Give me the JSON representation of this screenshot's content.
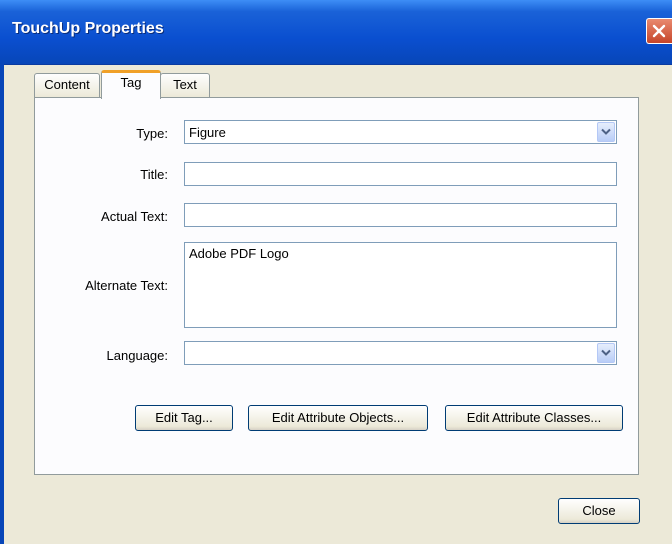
{
  "window": {
    "title": "TouchUp Properties"
  },
  "tabs": [
    {
      "label": "Content"
    },
    {
      "label": "Tag"
    },
    {
      "label": "Text"
    }
  ],
  "active_tab": "Tag",
  "form": {
    "type_label": "Type:",
    "type_value": "Figure",
    "title_label": "Title:",
    "title_value": "",
    "actual_text_label": "Actual Text:",
    "actual_text_value": "",
    "alternate_text_label": "Alternate Text:",
    "alternate_text_value": "Adobe PDF Logo",
    "language_label": "Language:",
    "language_value": ""
  },
  "buttons": {
    "edit_tag": "Edit Tag...",
    "edit_attribute_objects": "Edit Attribute Objects...",
    "edit_attribute_classes": "Edit Attribute Classes...",
    "close": "Close"
  },
  "icons": {
    "close_window": "close-icon",
    "dropdown": "chevron-down-icon"
  },
  "colors": {
    "titlebar": "#0a4fd0",
    "close_button": "#c6452a",
    "active_tab_accent": "#f0a028",
    "window_bg": "#ece9d8"
  }
}
